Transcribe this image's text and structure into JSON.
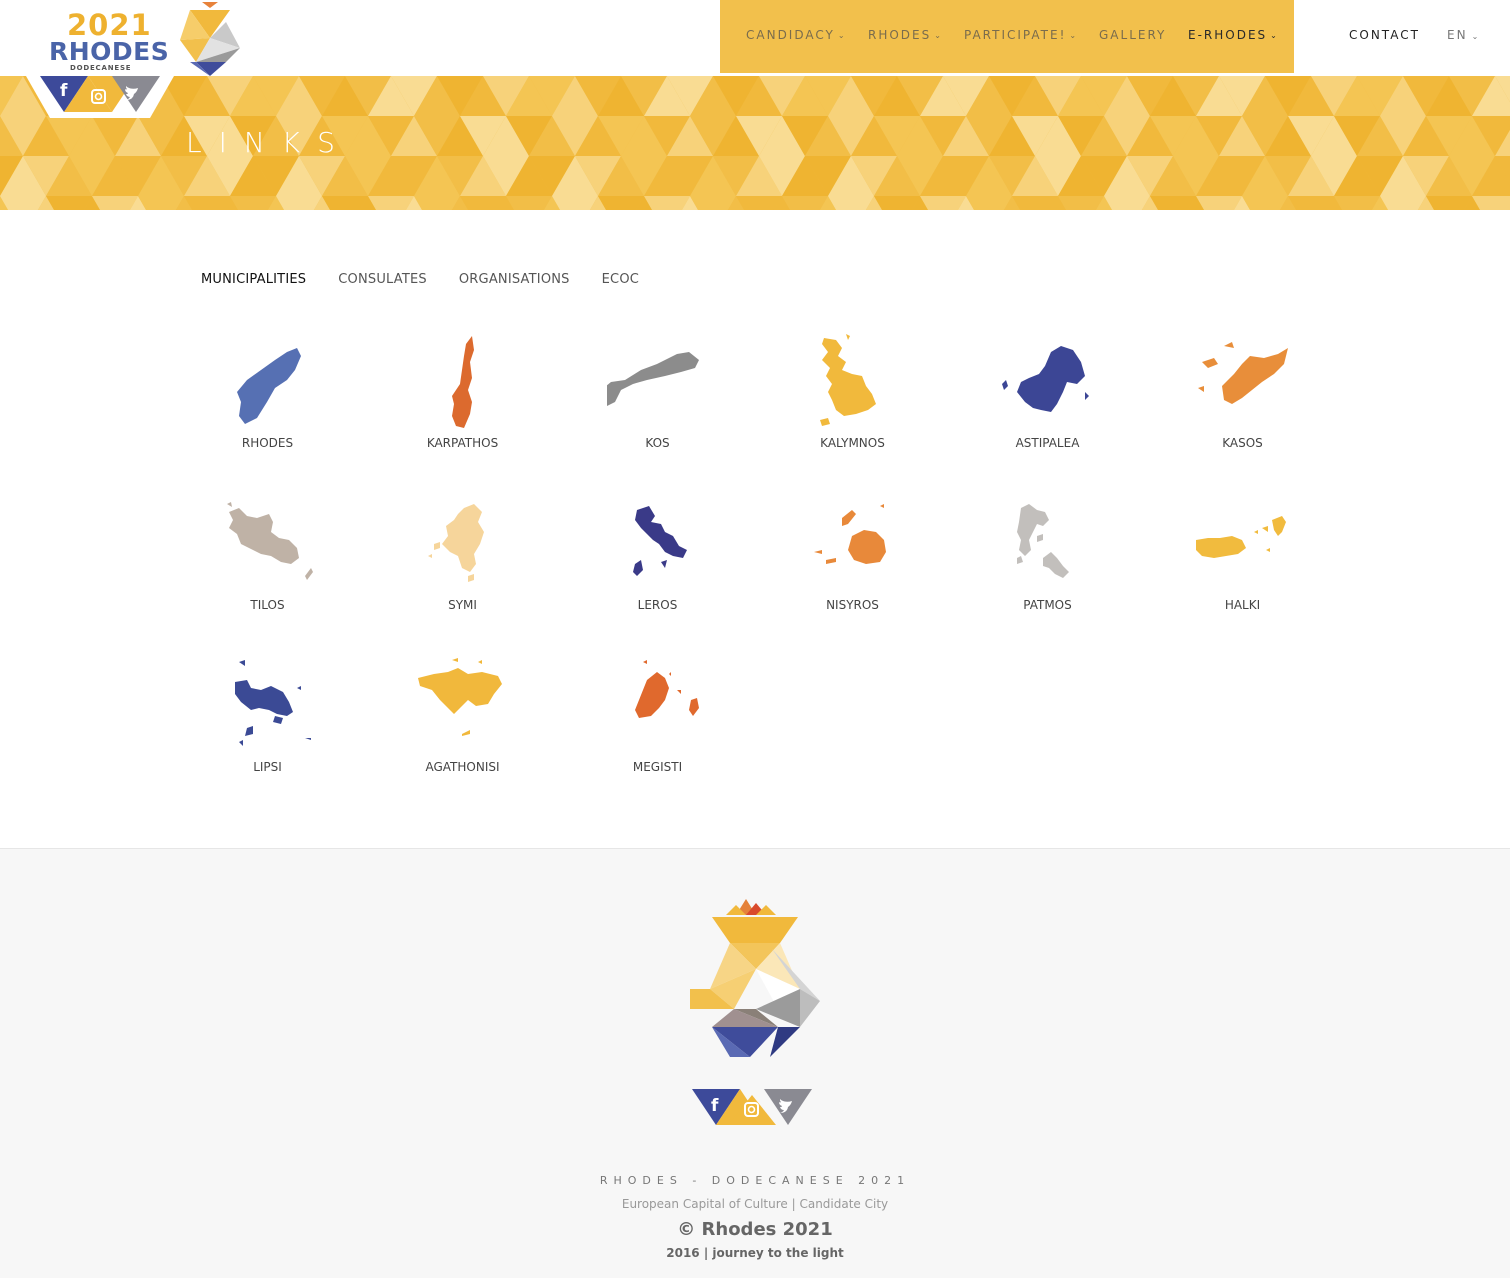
{
  "brand": {
    "year": "2021",
    "name": "RHODES",
    "subtitle": "DODECANESE",
    "colors": {
      "yellow": "#f2c04c",
      "blue": "#3f4c9b",
      "orange": "#e6873a",
      "grey": "#8c8c8c"
    }
  },
  "social": [
    {
      "name": "facebook",
      "glyph": "f"
    },
    {
      "name": "instagram",
      "glyph": "◙"
    },
    {
      "name": "twitter",
      "glyph": "🐦"
    }
  ],
  "nav": {
    "items": [
      {
        "label": "CANDIDACY",
        "dropdown": true
      },
      {
        "label": "RHODES",
        "dropdown": true
      },
      {
        "label": "PARTICIPATE!",
        "dropdown": true
      },
      {
        "label": "GALLERY",
        "dropdown": false
      },
      {
        "label": "E-RHODES",
        "dropdown": true
      }
    ],
    "contact": "CONTACT",
    "language": "EN"
  },
  "banner": {
    "title": "LINKS"
  },
  "tabs": [
    {
      "label": "MUNICIPALITIES",
      "active": true
    },
    {
      "label": "CONSULATES",
      "active": false
    },
    {
      "label": "ORGANISATIONS",
      "active": false
    },
    {
      "label": "ECOC",
      "active": false
    }
  ],
  "islands": [
    {
      "name": "RHODES",
      "color": "#5670b3"
    },
    {
      "name": "KARPATHOS",
      "color": "#dc6a2e"
    },
    {
      "name": "KOS",
      "color": "#8c8c8c"
    },
    {
      "name": "KALYMNOS",
      "color": "#f1b93c"
    },
    {
      "name": "ASTIPALEA",
      "color": "#3c4695"
    },
    {
      "name": "KASOS",
      "color": "#e88e3a"
    },
    {
      "name": "TILOS",
      "color": "#bfb2a6"
    },
    {
      "name": "SYMI",
      "color": "#f6d59b"
    },
    {
      "name": "LEROS",
      "color": "#3a3a88"
    },
    {
      "name": "NISYROS",
      "color": "#e8893a"
    },
    {
      "name": "PATMOS",
      "color": "#c2bfbc"
    },
    {
      "name": "HALKI",
      "color": "#f1bb3e"
    },
    {
      "name": "LIPSI",
      "color": "#3b4a95"
    },
    {
      "name": "AGATHONISI",
      "color": "#f1b83c"
    },
    {
      "name": "MEGISTI",
      "color": "#e0692d"
    }
  ],
  "footer": {
    "line1": "RHODES - DODECANESE 2021",
    "line2": "European Capital of Culture | Candidate City",
    "line3": "© Rhodes 2021",
    "line4": "2016 | journey to the light"
  }
}
